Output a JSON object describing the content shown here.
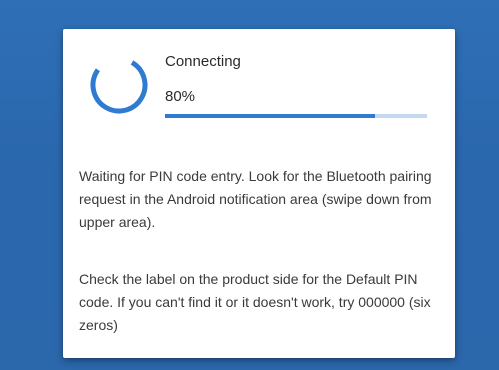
{
  "dialog": {
    "status_title": "Connecting",
    "progress_text": "80%",
    "progress_value": 80,
    "message_1": "Waiting for PIN code entry. Look for the Bluetooth pairing request in the Android notification area (swipe down from upper area).",
    "message_2": "Check the label on the product side for the Default PIN code. If you can't find it or it doesn't work, try 000000 (six zeros)"
  },
  "icons": {
    "spinner": "loading-spinner-icon"
  },
  "colors": {
    "background": "#2b67ab",
    "accent": "#2f7bd1",
    "progress_track": "#c4d8ef",
    "card": "#ffffff"
  }
}
